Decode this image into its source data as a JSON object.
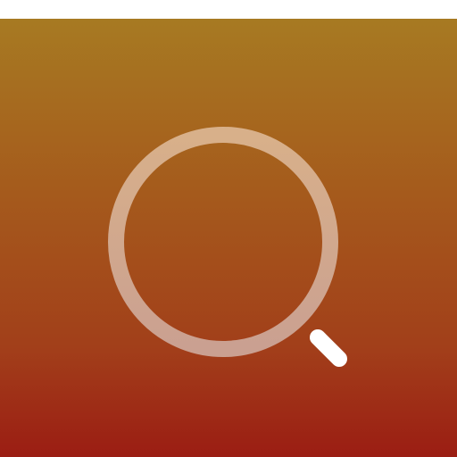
{
  "icon": {
    "name": "search-icon",
    "colors": {
      "background_top": "#a77a22",
      "background_bottom": "#9b1d13",
      "ring_top": "#d8b08a",
      "ring_bottom": "#caa091",
      "handle": "#ffffff",
      "top_border": "#ffffff"
    }
  }
}
